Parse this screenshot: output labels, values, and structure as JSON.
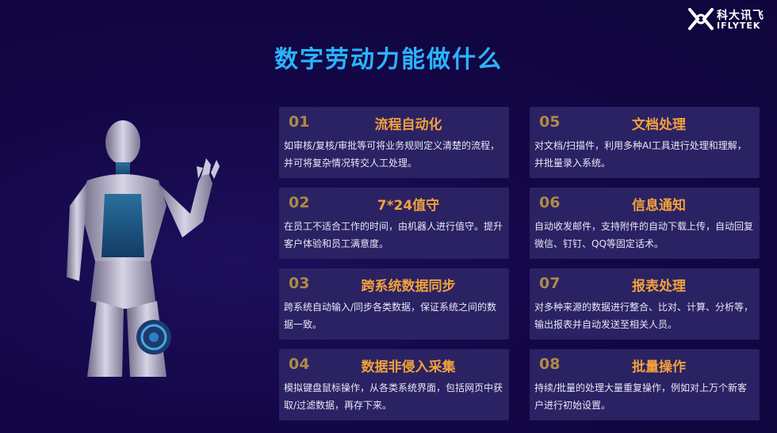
{
  "logo": {
    "cn": "科大讯飞",
    "en": "IFLYTEK"
  },
  "title": "数字劳动力能做什么",
  "robot": {
    "icon": "humanoid-robot-image"
  },
  "items": [
    {
      "num": "01",
      "title": "流程自动化",
      "text": "如审核/复核/审批等可将业务规则定义清楚的流程，并可将复杂情况转交人工处理。"
    },
    {
      "num": "02",
      "title": "7*24值守",
      "text": "在员工不适合工作的时间，由机器人进行值守。提升客户体验和员工满意度。"
    },
    {
      "num": "03",
      "title": "跨系统数据同步",
      "text": "跨系统自动输入/同步各类数据，保证系统之间的数据一致。"
    },
    {
      "num": "04",
      "title": "数据非侵入采集",
      "text": "模拟键盘鼠标操作，从各类系统界面，包括网页中获取/过滤数据，再存下来。"
    },
    {
      "num": "05",
      "title": "文档处理",
      "text": "对文档/扫描件，利用多种AI工具进行处理和理解，并批量录入系统。"
    },
    {
      "num": "06",
      "title": "信息通知",
      "text": "自动收发邮件，支持附件的自动下载上传，自动回复微信、钉钉、QQ等固定话术。"
    },
    {
      "num": "07",
      "title": "报表处理",
      "text": "对多种来源的数据进行整合、比对、计算、分析等，输出报表并自动发送至相关人员。"
    },
    {
      "num": "08",
      "title": "批量操作",
      "text": "持续/批量的处理大量重复操作，例如对上万个新客户进行初始设置。"
    }
  ]
}
